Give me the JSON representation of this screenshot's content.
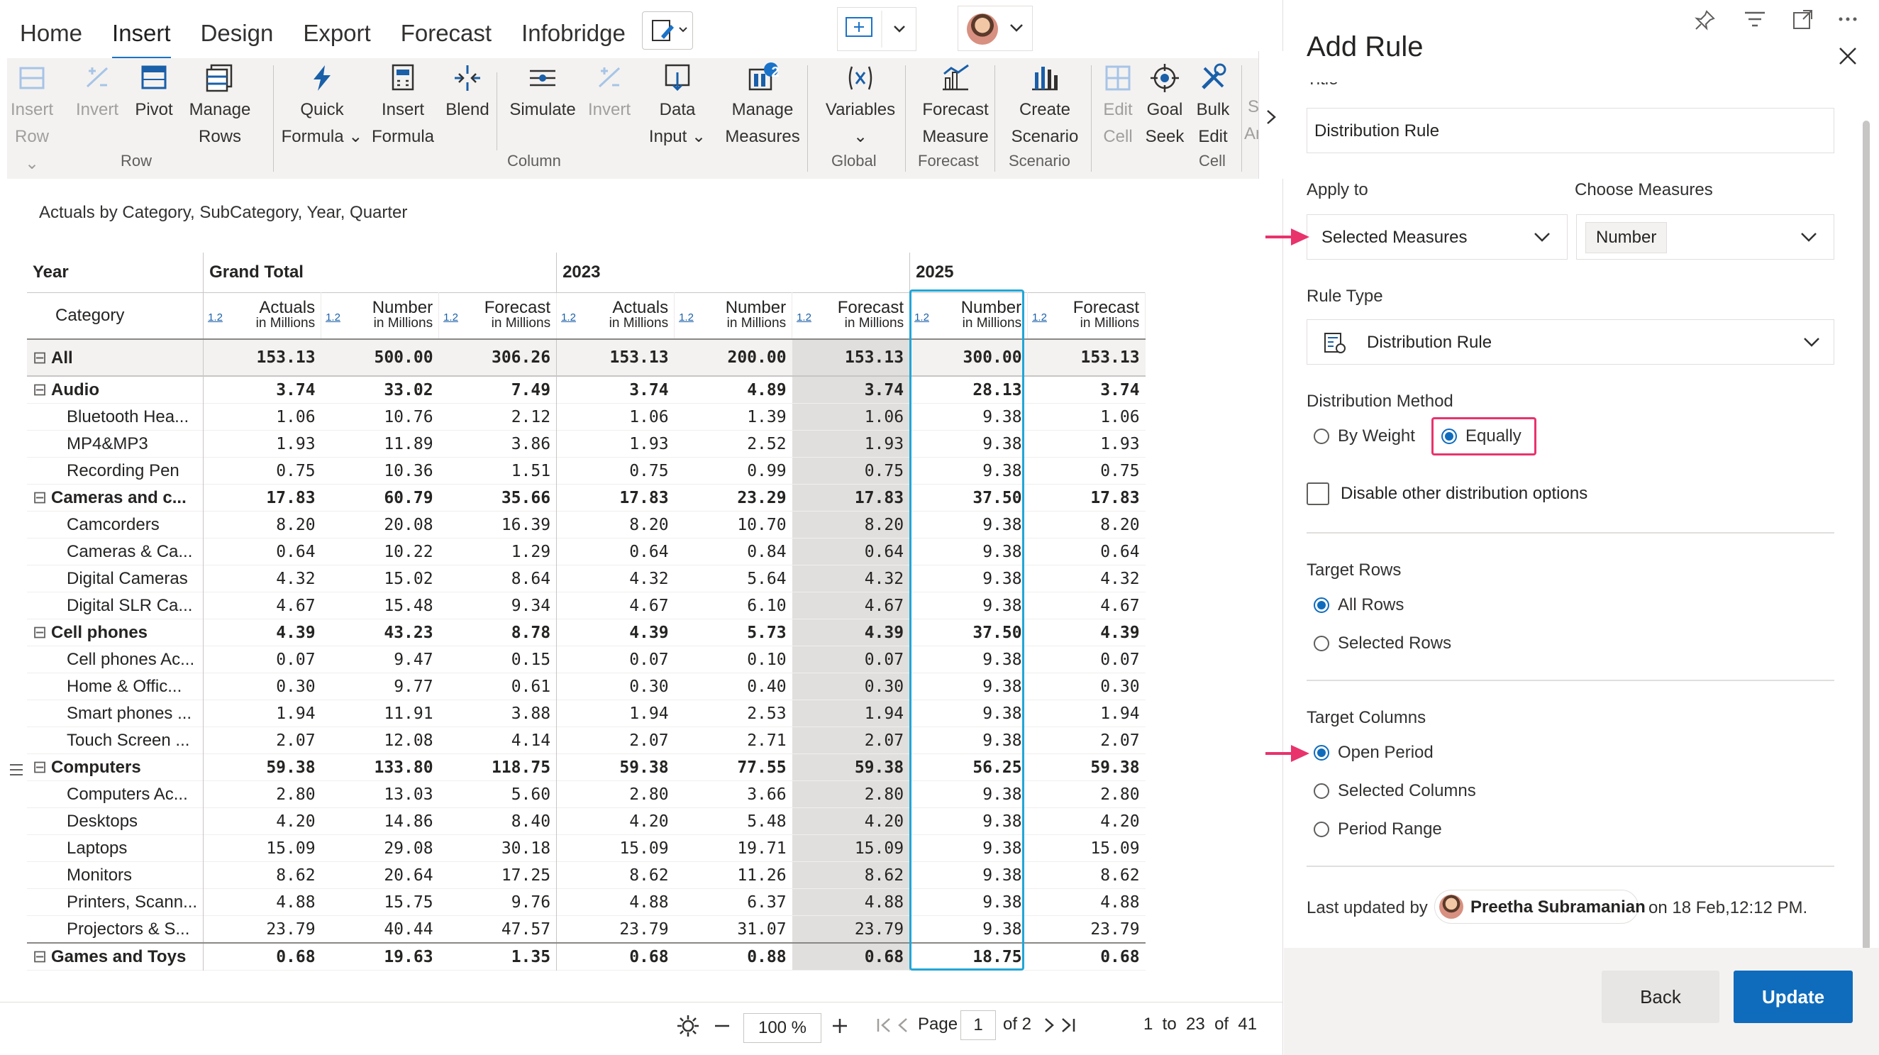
{
  "menu": {
    "tabs": [
      "Home",
      "Insert",
      "Design",
      "Export",
      "Forecast",
      "Infobridge"
    ],
    "active": "Insert"
  },
  "ribbon": {
    "row_group": {
      "label": "Row",
      "buttons": [
        {
          "l1": "Insert",
          "l2": "Row ⌄",
          "disabled": true
        },
        {
          "l1": "Invert",
          "l2": "",
          "disabled": true
        },
        {
          "l1": "Pivot",
          "l2": "",
          "disabled": false
        },
        {
          "l1": "Manage",
          "l2": "Rows",
          "disabled": false
        }
      ]
    },
    "column_group": {
      "label": "Column",
      "buttons": [
        {
          "l1": "Quick",
          "l2": "Formula ⌄",
          "disabled": false
        },
        {
          "l1": "Insert",
          "l2": "Formula",
          "disabled": false
        },
        {
          "l1": "Blend",
          "l2": "",
          "disabled": false
        },
        {
          "l1": "Simulate",
          "l2": "",
          "disabled": false
        },
        {
          "l1": "Invert",
          "l2": "",
          "disabled": true
        },
        {
          "l1": "Data",
          "l2": "Input ⌄",
          "disabled": false
        },
        {
          "l1": "Manage",
          "l2": "Measures",
          "disabled": false,
          "badge": "2"
        }
      ]
    },
    "global_group": {
      "label": "Global",
      "buttons": [
        {
          "l1": "Variables",
          "l2": "⌄",
          "disabled": false
        }
      ]
    },
    "forecast_group": {
      "label": "Forecast",
      "buttons": [
        {
          "l1": "Forecast",
          "l2": "Measure",
          "disabled": false
        }
      ]
    },
    "scenario_group": {
      "label": "Scenario",
      "buttons": [
        {
          "l1": "Create",
          "l2": "Scenario",
          "disabled": false
        }
      ]
    },
    "cell_group": {
      "label": "Cell",
      "buttons": [
        {
          "l1": "Edit",
          "l2": "Cell",
          "disabled": true
        },
        {
          "l1": "Goal",
          "l2": "Seek",
          "disabled": false
        },
        {
          "l1": "Bulk",
          "l2": "Edit",
          "disabled": false
        }
      ]
    },
    "overflow_labels": [
      "S",
      "An"
    ]
  },
  "grid": {
    "subtitle": "Actuals by Category, SubCategory, Year, Quarter",
    "year_label": "Year",
    "category_label": "Category",
    "year_groups": [
      "Grand Total",
      "2023",
      "2025"
    ],
    "measures": [
      {
        "name": "Actuals",
        "unit": "in Millions"
      },
      {
        "name": "Number",
        "unit": "in Millions"
      },
      {
        "name": "Forecast",
        "unit": "in Millions"
      },
      {
        "name": "Actuals",
        "unit": "in Millions"
      },
      {
        "name": "Number",
        "unit": "in Millions"
      },
      {
        "name": "Forecast",
        "unit": "in Millions"
      },
      {
        "name": "Number",
        "unit": "in Millions"
      },
      {
        "name": "Forecast",
        "unit": "in Millions"
      }
    ],
    "scale_tag": "1.2",
    "rows": [
      {
        "label": "All",
        "level": 0,
        "bold": true,
        "expand": true,
        "v": [
          "153.13",
          "500.00",
          "306.26",
          "153.13",
          "200.00",
          "153.13",
          "300.00",
          "153.13"
        ]
      },
      {
        "label": "Audio",
        "level": 0,
        "bold": true,
        "expand": true,
        "v": [
          "3.74",
          "33.02",
          "7.49",
          "3.74",
          "4.89",
          "3.74",
          "28.13",
          "3.74"
        ]
      },
      {
        "label": "Bluetooth Hea...",
        "level": 1,
        "v": [
          "1.06",
          "10.76",
          "2.12",
          "1.06",
          "1.39",
          "1.06",
          "9.38",
          "1.06"
        ]
      },
      {
        "label": "MP4&MP3",
        "level": 1,
        "v": [
          "1.93",
          "11.89",
          "3.86",
          "1.93",
          "2.52",
          "1.93",
          "9.38",
          "1.93"
        ]
      },
      {
        "label": "Recording Pen",
        "level": 1,
        "v": [
          "0.75",
          "10.36",
          "1.51",
          "0.75",
          "0.99",
          "0.75",
          "9.38",
          "0.75"
        ]
      },
      {
        "label": "Cameras and c...",
        "level": 0,
        "bold": true,
        "expand": true,
        "v": [
          "17.83",
          "60.79",
          "35.66",
          "17.83",
          "23.29",
          "17.83",
          "37.50",
          "17.83"
        ]
      },
      {
        "label": "Camcorders",
        "level": 1,
        "v": [
          "8.20",
          "20.08",
          "16.39",
          "8.20",
          "10.70",
          "8.20",
          "9.38",
          "8.20"
        ]
      },
      {
        "label": "Cameras & Ca...",
        "level": 1,
        "v": [
          "0.64",
          "10.22",
          "1.29",
          "0.64",
          "0.84",
          "0.64",
          "9.38",
          "0.64"
        ]
      },
      {
        "label": "Digital Cameras",
        "level": 1,
        "v": [
          "4.32",
          "15.02",
          "8.64",
          "4.32",
          "5.64",
          "4.32",
          "9.38",
          "4.32"
        ]
      },
      {
        "label": "Digital SLR Ca...",
        "level": 1,
        "v": [
          "4.67",
          "15.48",
          "9.34",
          "4.67",
          "6.10",
          "4.67",
          "9.38",
          "4.67"
        ]
      },
      {
        "label": "Cell phones",
        "level": 0,
        "bold": true,
        "expand": true,
        "v": [
          "4.39",
          "43.23",
          "8.78",
          "4.39",
          "5.73",
          "4.39",
          "37.50",
          "4.39"
        ]
      },
      {
        "label": "Cell phones Ac...",
        "level": 1,
        "v": [
          "0.07",
          "9.47",
          "0.15",
          "0.07",
          "0.10",
          "0.07",
          "9.38",
          "0.07"
        ]
      },
      {
        "label": "Home & Offic...",
        "level": 1,
        "v": [
          "0.30",
          "9.77",
          "0.61",
          "0.30",
          "0.40",
          "0.30",
          "9.38",
          "0.30"
        ]
      },
      {
        "label": "Smart phones ...",
        "level": 1,
        "v": [
          "1.94",
          "11.91",
          "3.88",
          "1.94",
          "2.53",
          "1.94",
          "9.38",
          "1.94"
        ]
      },
      {
        "label": "Touch Screen ...",
        "level": 1,
        "v": [
          "2.07",
          "12.08",
          "4.14",
          "2.07",
          "2.71",
          "2.07",
          "9.38",
          "2.07"
        ]
      },
      {
        "label": "Computers",
        "level": 0,
        "bold": true,
        "expand": true,
        "v": [
          "59.38",
          "133.80",
          "118.75",
          "59.38",
          "77.55",
          "59.38",
          "56.25",
          "59.38"
        ]
      },
      {
        "label": "Computers Ac...",
        "level": 1,
        "v": [
          "2.80",
          "13.03",
          "5.60",
          "2.80",
          "3.66",
          "2.80",
          "9.38",
          "2.80"
        ]
      },
      {
        "label": "Desktops",
        "level": 1,
        "v": [
          "4.20",
          "14.86",
          "8.40",
          "4.20",
          "5.48",
          "4.20",
          "9.38",
          "4.20"
        ]
      },
      {
        "label": "Laptops",
        "level": 1,
        "v": [
          "15.09",
          "29.08",
          "30.18",
          "15.09",
          "19.71",
          "15.09",
          "9.38",
          "15.09"
        ]
      },
      {
        "label": "Monitors",
        "level": 1,
        "v": [
          "8.62",
          "20.64",
          "17.25",
          "8.62",
          "11.26",
          "8.62",
          "9.38",
          "8.62"
        ]
      },
      {
        "label": "Printers, Scann...",
        "level": 1,
        "v": [
          "4.88",
          "15.75",
          "9.76",
          "4.88",
          "6.37",
          "4.88",
          "9.38",
          "4.88"
        ]
      },
      {
        "label": "Projectors & S...",
        "level": 1,
        "v": [
          "23.79",
          "40.44",
          "47.57",
          "23.79",
          "31.07",
          "23.79",
          "9.38",
          "23.79"
        ]
      },
      {
        "label": "Games and Toys",
        "level": 0,
        "bold": true,
        "expand": true,
        "v": [
          "0.68",
          "19.63",
          "1.35",
          "0.68",
          "0.88",
          "0.68",
          "18.75",
          "0.68"
        ]
      }
    ]
  },
  "footer": {
    "zoom": "100 %",
    "page_label": "Page",
    "page_value": "1",
    "page_total": "of 2",
    "range": "1  to  23  of  41"
  },
  "panel": {
    "title": "Add Rule",
    "title_field_label": "Title",
    "title_value": "Distribution Rule",
    "apply_to_label": "Apply to",
    "apply_to_value": "Selected Measures",
    "choose_measures_label": "Choose Measures",
    "measure_chip": "Number",
    "rule_type_label": "Rule Type",
    "rule_type_value": "Distribution Rule",
    "dist_method_label": "Distribution Method",
    "dist_options": [
      "By Weight",
      "Equally"
    ],
    "dist_selected": 1,
    "disable_label": "Disable other distribution options",
    "target_rows_label": "Target Rows",
    "target_rows_options": [
      "All Rows",
      "Selected Rows"
    ],
    "target_rows_selected": 0,
    "target_cols_label": "Target Columns",
    "target_cols_options": [
      "Open Period",
      "Selected Columns",
      "Period Range"
    ],
    "target_cols_selected": 0,
    "updated_prefix": "Last updated by",
    "updated_user": "Preetha Subramanian",
    "updated_suffix": "on 18 Feb,12:12 PM.",
    "back_label": "Back",
    "update_label": "Update",
    "accent": "#0f6cbd",
    "highlight": "#e8336d"
  }
}
